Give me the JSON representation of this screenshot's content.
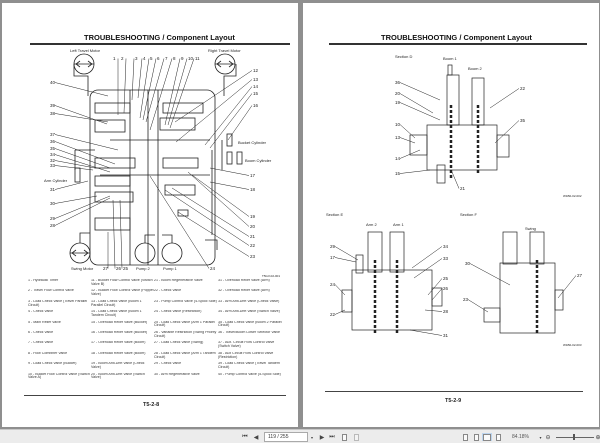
{
  "left_page": {
    "title": "TROUBLESHOOTING / Component Layout",
    "page_number": "T5-2-8",
    "figure_code": "T5GV-02-001",
    "labels": {
      "left_travel_motor": "Left Travel Motor",
      "right_travel_motor": "Right Travel Motor",
      "bucket_cylinder": "Bucket Cylinder",
      "boom_cylinder": "Boom Cylinder",
      "arm_cylinder": "Arm Cylinder",
      "swing_motor": "Swing Motor",
      "pump2": "Pump 2",
      "pump1": "Pump 1"
    },
    "callouts": [
      "1",
      "2",
      "3",
      "4",
      "5",
      "6",
      "7",
      "8",
      "9",
      "10",
      "11",
      "12",
      "13",
      "14",
      "15",
      "16",
      "17",
      "18",
      "19",
      "20",
      "21",
      "22",
      "23",
      "24",
      "25",
      "26",
      "27",
      "28",
      "29",
      "30",
      "31",
      "32",
      "33",
      "34",
      "35",
      "36",
      "37",
      "38",
      "39",
      "40"
    ],
    "legend": [
      "1 - Hydraulic Timer",
      "2 - Travel Flow Control Valve",
      "3 - Load Check Valve (Travel Parallel Circuit)",
      "4 - Check Valve",
      "5 - Main Relief Valve",
      "6 - Check Valve",
      "7 - Check Valve",
      "8 - Flow Combiner Valve",
      "9 - Load Check Valve (Bucket)",
      "10 - Bucket Flow Control Valve (Switch Valve A)",
      "11 - Bucket Flow Control Valve (Switch Valve B)",
      "12 - Bucket Flow Control Valve (Poppet Valve)",
      "13 - Load Check Valve (Boom 1 Parallel Circuit)",
      "14 - Load Check Valve (Boom 1 Tandem Circuit)",
      "15 - Overload Relief Valve (Bucket)",
      "16 - Overload Relief Valve (Bucket)",
      "17 - Overload Relief Valve (Boom)",
      "18 - Overload Relief Valve (Boom)",
      "19 - Boom Anti-Drift Valve (Check Valve)",
      "20 - Boom Anti-Drift Valve (Switch Valve)",
      "21 - Boom Regenerative Valve",
      "22 - Check Valve",
      "23 - Pump Control Valve (4-Spool Side)",
      "24 - Check Valve (Restriction)",
      "25 - Load Check Valve (Arm 1 Parallel Circuit)",
      "26 - Variable Restriction (Swing Priority Circuit)",
      "27 - Load Check Valve (Swing)",
      "28 - Load Check Valve (Arm 1 Tandem Circuit)",
      "29 - Check Valve",
      "30 - Arm Regenerative Valve",
      "31 - Overload Relief Valve (Arm)",
      "32 - Overload Relief Valve (Arm)",
      "33 - Arm Anti-Drift Valve (Check Valve)",
      "34 - Arm Anti-Drift Valve (Switch Valve)",
      "35 - Load Check Valve (Boom 2 Parallel Circuit)",
      "36 - Travel/Boom Lower Selector Valve",
      "37 - Aux. Circuit Flow Control Valve (Switch Valve)",
      "38 - Aux Circuit Flow Control Valve (Restriction)",
      "39 - Load Check Valve (Travel Tandem Circuit)",
      "40 - Pump Control Valve (5-Spool Side)"
    ]
  },
  "right_page": {
    "title": "TROUBLESHOOTING / Component Layout",
    "page_number": "T5-2-9",
    "section_d": {
      "title": "Section D",
      "boom1": "Boom 1",
      "boom2": "Boom 2",
      "code": "W1B0-02-002",
      "callouts": [
        "36",
        "20",
        "19",
        "10",
        "13",
        "14",
        "15",
        "21",
        "22",
        "35"
      ]
    },
    "section_e": {
      "title": "Section E",
      "arm2": "Arm 2",
      "arm1": "Arm 1",
      "callouts": [
        "29",
        "17",
        "24",
        "22",
        "34",
        "33",
        "25",
        "26",
        "28",
        "31"
      ]
    },
    "section_f": {
      "title": "Section F",
      "swing": "Swing",
      "code": "W1B0-02-003",
      "callouts": [
        "30",
        "23",
        "27"
      ]
    }
  },
  "toolbar": {
    "page_display": "119 / 255",
    "zoom": "84.18%",
    "icons": [
      "first-page-icon",
      "prev-page-icon",
      "next-page-icon",
      "last-page-icon",
      "rotate-icon",
      "fit-icon",
      "single-page-icon",
      "continuous-icon",
      "two-page-icon",
      "scroll-icon",
      "zoom-out-icon",
      "zoom-in-icon"
    ]
  }
}
